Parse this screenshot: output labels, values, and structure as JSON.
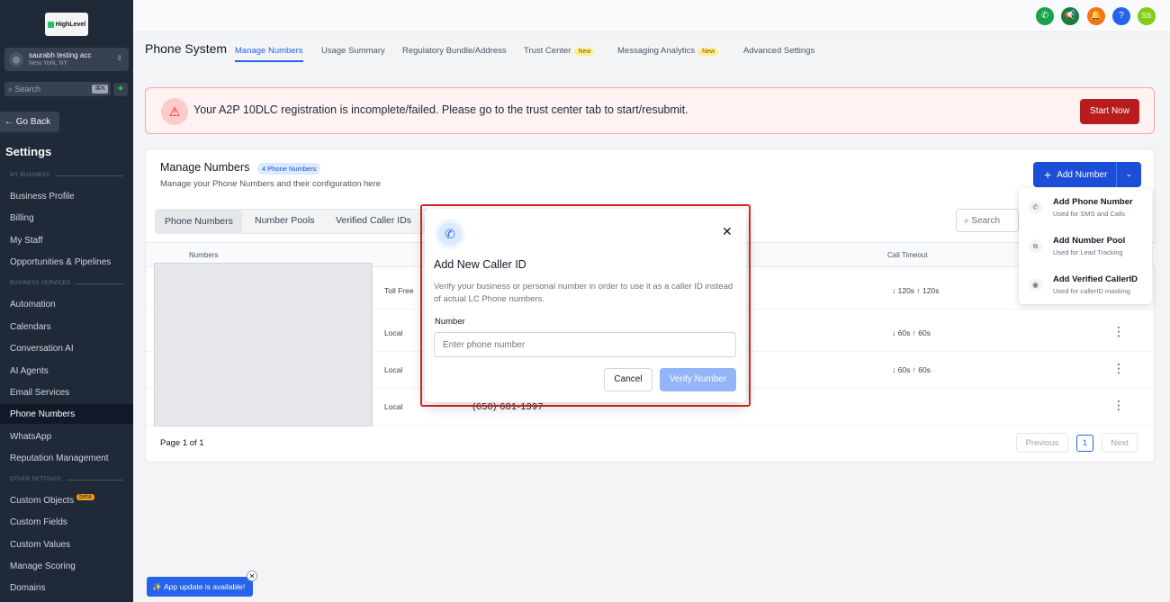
{
  "sidebar": {
    "logo_text": "HighLevel",
    "account_name": "saurabh testing acc",
    "account_location": "New York, NY",
    "search_placeholder": "Search",
    "search_shortcut": "⌘K",
    "go_back": "← Go Back",
    "settings_title": "Settings",
    "sections": {
      "my_business": "MY BUSINESS",
      "business_services": "BUSINESS SERVICES",
      "other_settings": "OTHER SETTINGS"
    },
    "items": [
      "Business Profile",
      "Billing",
      "My Staff",
      "Opportunities & Pipelines",
      "Automation",
      "Calendars",
      "Conversation AI",
      "AI Agents",
      "Email Services",
      "Phone Numbers",
      "WhatsApp",
      "Reputation Management",
      "Custom Objects",
      "Custom Fields",
      "Custom Values",
      "Manage Scoring",
      "Domains"
    ],
    "beta_label": "beta"
  },
  "topbar": {
    "avatar_initials": "SS",
    "help_label": "?"
  },
  "nav": {
    "title": "Phone System",
    "tabs": [
      "Manage Numbers",
      "Usage Summary",
      "Regulatory Bundle/Address",
      "Trust Center",
      "Messaging Analytics",
      "Advanced Settings"
    ],
    "new_label": "New"
  },
  "alert": {
    "message": "Your A2P 10DLC registration is incomplete/failed. Please go to the trust center tab to start/resubmit.",
    "button": "Start Now"
  },
  "card": {
    "title": "Manage Numbers",
    "badge": "4 Phone Numbers",
    "subtitle": "Manage your Phone Numbers and their configuration here",
    "add_button": "Add Number",
    "subtabs": [
      "Phone Numbers",
      "Number Pools",
      "Verified Caller IDs"
    ],
    "search_placeholder": "Search",
    "columns": {
      "numbers": "Numbers",
      "call_timeout": "Call Timeout"
    },
    "rows": [
      {
        "type": "Toll Free",
        "number": "",
        "timeout": "↓ 120s   ↑ 120s"
      },
      {
        "type": "Local",
        "number": "",
        "timeout": "↓ 60s   ↑ 60s"
      },
      {
        "type": "Local",
        "number": "",
        "timeout": "↓ 60s   ↑ 60s"
      },
      {
        "type": "Local",
        "number": "(650) 681-1397",
        "timeout": ""
      }
    ],
    "page_info": "Page 1 of 1",
    "previous": "Previous",
    "page_number": "1",
    "next": "Next"
  },
  "dropdown": {
    "items": [
      {
        "title": "Add Phone Number",
        "sub": "Used for SMS and Calls"
      },
      {
        "title": "Add Number Pool",
        "sub": "Used for Lead Tracking"
      },
      {
        "title": "Add Verified CallerID",
        "sub": "Used for callerID masking"
      }
    ]
  },
  "modal": {
    "title": "Add New Caller ID",
    "description": "Verify your business or personal number in order to use it as a caller ID instead of actual LC Phone numbers.",
    "field_label": "Number",
    "placeholder": "Enter phone number",
    "cancel": "Cancel",
    "verify": "Verify Number"
  },
  "toast": {
    "message": "App update is available!"
  }
}
